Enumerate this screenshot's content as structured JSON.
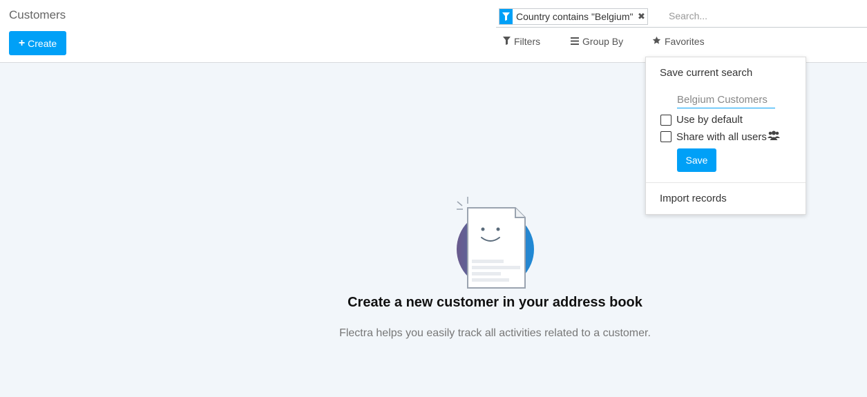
{
  "breadcrumb": "Customers",
  "toolbar": {
    "create_label": "Create"
  },
  "search": {
    "facet_label": "Country contains \"Belgium\"",
    "placeholder": "Search..."
  },
  "filter_buttons": {
    "filters": "Filters",
    "group_by": "Group By",
    "favorites": "Favorites"
  },
  "favorites_dropdown": {
    "header": "Save current search",
    "name_value": "Belgium Customers",
    "use_by_default": "Use by default",
    "share_with_all": "Share with all users",
    "save_label": "Save",
    "import_label": "Import records"
  },
  "empty_state": {
    "title": "Create a new customer in your address book",
    "text": "Flectra helps you easily track all activities related to a customer."
  },
  "colors": {
    "primary": "#00a0f7",
    "background": "#f2f6fa"
  }
}
